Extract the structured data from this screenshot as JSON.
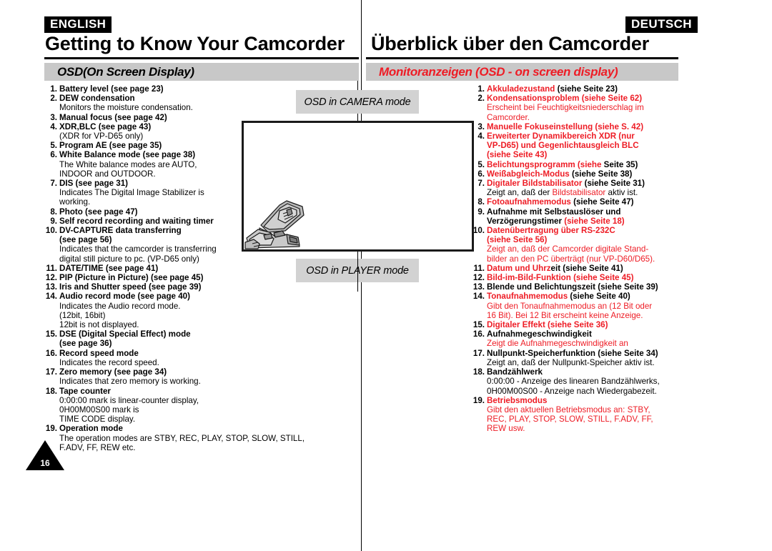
{
  "page": {
    "number": "16"
  },
  "left": {
    "language_badge": "ENGLISH",
    "chapter_title": "Getting to Know Your Camcorder",
    "section_band": "OSD(On Screen Display)",
    "items": [
      {
        "num": "1.",
        "lines": [
          {
            "t": "Battery level (see page 23)",
            "b": true,
            "c": "black"
          }
        ]
      },
      {
        "num": "2.",
        "lines": [
          {
            "t": "DEW condensation",
            "b": true,
            "c": "black"
          },
          {
            "t": "Monitors the moisture condensation.",
            "b": false,
            "c": "black"
          }
        ]
      },
      {
        "num": "3.",
        "lines": [
          {
            "t": "Manual focus (see page 42)",
            "b": true,
            "c": "black"
          }
        ]
      },
      {
        "num": "4.",
        "lines": [
          {
            "t": "XDR,BLC (see page 43)",
            "b": true,
            "c": "black"
          },
          {
            "t": "(XDR for VP-D65 only)",
            "b": false,
            "c": "black"
          }
        ]
      },
      {
        "num": "5.",
        "lines": [
          {
            "t": "Program AE (see page 35)",
            "b": true,
            "c": "black"
          }
        ]
      },
      {
        "num": "6.",
        "lines": [
          {
            "t": "White Balance mode (see page 38)",
            "b": true,
            "c": "black"
          },
          {
            "t": "The White balance modes are AUTO,",
            "b": false,
            "c": "black"
          },
          {
            "t": "INDOOR and OUTDOOR.",
            "b": false,
            "c": "black"
          }
        ]
      },
      {
        "num": "7.",
        "lines": [
          {
            "t": "DIS (see page 31)",
            "b": true,
            "c": "black"
          },
          {
            "t": "Indicates The Digital Image Stabilizer is",
            "b": false,
            "c": "black"
          },
          {
            "t": "working.",
            "b": false,
            "c": "black"
          }
        ]
      },
      {
        "num": "8.",
        "lines": [
          {
            "t": "Photo (see page 47)",
            "b": true,
            "c": "black"
          }
        ]
      },
      {
        "num": "9.",
        "lines": [
          {
            "t": "Self record recording and waiting timer",
            "b": true,
            "c": "black"
          }
        ]
      },
      {
        "num": "10.",
        "lines": [
          {
            "t": "DV-CAPTURE data transferring",
            "b": true,
            "c": "black"
          },
          {
            "t": "(see page 56)",
            "b": true,
            "c": "black",
            "ind": true
          },
          {
            "t": "Indicates that the camcorder is transferring",
            "b": false,
            "c": "black",
            "ind": true
          },
          {
            "t": "digital still picture to pc. (VP-D65 only)",
            "b": false,
            "c": "black",
            "ind": true
          }
        ]
      },
      {
        "num": "11.",
        "lines": [
          {
            "t": "DATE/TIME (see page 41)",
            "b": true,
            "c": "black"
          }
        ]
      },
      {
        "num": "12.",
        "lines": [
          {
            "t": "PIP (Picture in Picture) (see page 45)",
            "b": true,
            "c": "black"
          }
        ]
      },
      {
        "num": "13.",
        "lines": [
          {
            "t": "Iris and Shutter speed (see page 39)",
            "b": true,
            "c": "black"
          }
        ]
      },
      {
        "num": "14.",
        "lines": [
          {
            "t": "Audio record mode (see page 40)",
            "b": true,
            "c": "black"
          },
          {
            "t": "Indicates the Audio record mode.",
            "b": false,
            "c": "black"
          },
          {
            "t": "(12bit, 16bit)",
            "b": false,
            "c": "black"
          },
          {
            "t": "12bit is not displayed.",
            "b": false,
            "c": "black"
          }
        ]
      },
      {
        "num": "15.",
        "lines": [
          {
            "t": "DSE (Digital Special Effect) mode",
            "b": true,
            "c": "black"
          },
          {
            "t": "(see page 36)",
            "b": true,
            "c": "black",
            "ind": true
          }
        ]
      },
      {
        "num": "16.",
        "lines": [
          {
            "t": "Record speed mode",
            "b": true,
            "c": "black"
          },
          {
            "t": "Indicates the record speed.",
            "b": false,
            "c": "black"
          }
        ]
      },
      {
        "num": "17.",
        "lines": [
          {
            "t": "Zero memory (see page 34)",
            "b": true,
            "c": "black"
          },
          {
            "t": "Indicates that zero memory is working.",
            "b": false,
            "c": "black"
          }
        ]
      },
      {
        "num": "18.",
        "lines": [
          {
            "t": "Tape counter",
            "b": true,
            "c": "black"
          },
          {
            "t": "0:00:00 mark is linear-counter display,",
            "b": false,
            "c": "black"
          },
          {
            "t": "0H00M00S00 mark is",
            "b": false,
            "c": "black"
          },
          {
            "t": "TIME CODE display.",
            "b": false,
            "c": "black"
          }
        ]
      },
      {
        "num": "19.",
        "lines": [
          {
            "t": "Operation mode",
            "b": true,
            "c": "black"
          },
          {
            "t": "The operation modes are STBY, REC, PLAY, STOP, SLOW, STILL,",
            "b": false,
            "c": "black",
            "wide": true
          },
          {
            "t": "F.ADV, FF, REW etc.",
            "b": false,
            "c": "black",
            "wide": true
          }
        ]
      }
    ]
  },
  "right": {
    "language_badge": "DEUTSCH",
    "chapter_title": "Überblick über den Camcorder",
    "section_band": "Monitoranzeigen (OSD - on screen display)",
    "items": [
      {
        "num": "1.",
        "lines": [
          {
            "parts": [
              {
                "t": "Akkuladezustand ",
                "c": "red"
              },
              {
                "t": "(siehe Seite 23)",
                "c": "black"
              }
            ],
            "b": true
          }
        ]
      },
      {
        "num": "2.",
        "lines": [
          {
            "t": "Kondensationsproblem (siehe Seite 62)",
            "b": true,
            "c": "red"
          },
          {
            "t": "Erscheint bei Feuchtigkeitsniederschlag im",
            "b": false,
            "c": "red"
          },
          {
            "t": "Camcorder.",
            "b": false,
            "c": "red"
          }
        ]
      },
      {
        "num": "3.",
        "lines": [
          {
            "parts": [
              {
                "t": "Manuelle Fokuseinstellung ",
                "c": "red"
              },
              {
                "t": "(siehe S. 42)",
                "c": "red"
              }
            ],
            "b": true
          }
        ]
      },
      {
        "num": "4.",
        "lines": [
          {
            "t": "Erweiterter Dynamikbereich XDR (nur",
            "b": true,
            "c": "red"
          },
          {
            "t": "VP-D65) und Gegenlichtausgleich BLC",
            "b": true,
            "c": "red",
            "ind": true
          },
          {
            "t": "(siehe Seite 43)",
            "b": true,
            "c": "red",
            "ind": true
          }
        ]
      },
      {
        "num": "5.",
        "lines": [
          {
            "parts": [
              {
                "t": "Belichtungsprogramm (siehe ",
                "c": "red"
              },
              {
                "t": "Seite 35)",
                "c": "black"
              }
            ],
            "b": true
          }
        ]
      },
      {
        "num": "6.",
        "lines": [
          {
            "parts": [
              {
                "t": "Weißabgleich-Modus ",
                "c": "red"
              },
              {
                "t": "(siehe Seite 38)",
                "c": "black"
              }
            ],
            "b": true
          }
        ]
      },
      {
        "num": "7.",
        "lines": [
          {
            "parts": [
              {
                "t": "Digitaler Bildstabilisator ",
                "c": "red"
              },
              {
                "t": "(siehe Seite 31)",
                "c": "black"
              }
            ],
            "b": true
          },
          {
            "parts": [
              {
                "t": "Zeigt an, daß der ",
                "c": "black"
              },
              {
                "t": "Bildstabilisator ",
                "c": "red"
              },
              {
                "t": "aktiv ist.",
                "c": "black"
              }
            ],
            "b": false
          }
        ]
      },
      {
        "num": "8.",
        "lines": [
          {
            "parts": [
              {
                "t": "Fotoaufnahmemodus ",
                "c": "red"
              },
              {
                "t": "(siehe Seite 47)",
                "c": "black"
              }
            ],
            "b": true
          }
        ]
      },
      {
        "num": "9.",
        "lines": [
          {
            "t": "Aufnahme mit Selbstauslöser und",
            "b": true,
            "c": "black"
          },
          {
            "parts": [
              {
                "t": "Verzögerungstimer ",
                "c": "black"
              },
              {
                "t": "(siehe Seite 18)",
                "c": "red"
              }
            ],
            "b": true,
            "ind": true
          }
        ]
      },
      {
        "num": "10.",
        "lines": [
          {
            "t": "Datenübertragung über RS-232C",
            "b": true,
            "c": "red"
          },
          {
            "t": "(siehe Seite 56)",
            "b": true,
            "c": "red",
            "ind": true
          },
          {
            "t": "Zeigt an, daß der Camcorder digitale Stand-",
            "b": false,
            "c": "red",
            "ind": true
          },
          {
            "t": "bilder an den PC überträgt (nur VP-D60/D65).",
            "b": false,
            "c": "red",
            "ind": true
          }
        ]
      },
      {
        "num": "11.",
        "lines": [
          {
            "parts": [
              {
                "t": "Datum und Uhrz",
                "c": "red"
              },
              {
                "t": "eit (siehe Seite 41)",
                "c": "black"
              }
            ],
            "b": true
          }
        ]
      },
      {
        "num": "12.",
        "lines": [
          {
            "t": "Bild-im-Bild-Funktion (siehe Seite 45)",
            "b": true,
            "c": "red"
          }
        ]
      },
      {
        "num": "13.",
        "lines": [
          {
            "t": "Blende und Belichtungszeit (siehe Seite 39)",
            "b": true,
            "c": "black"
          }
        ]
      },
      {
        "num": "14.",
        "lines": [
          {
            "parts": [
              {
                "t": "Tonaufnahmemodus ",
                "c": "red"
              },
              {
                "t": "(siehe Seite 40)",
                "c": "black"
              }
            ],
            "b": true
          },
          {
            "t": "Gibt den Tonaufnahmemodus an (12 Bit oder",
            "b": false,
            "c": "red",
            "ind": true
          },
          {
            "t": "16 Bit). Bei 12 Bit erscheint keine Anzeige.",
            "b": false,
            "c": "red",
            "ind": true
          }
        ]
      },
      {
        "num": "15.",
        "lines": [
          {
            "t": "Digitaler Effekt (siehe Seite 36)",
            "b": true,
            "c": "red"
          }
        ]
      },
      {
        "num": "16.",
        "lines": [
          {
            "t": "Aufnahmegeschwindigkeit",
            "b": true,
            "c": "black"
          },
          {
            "t": "Zeigt die Aufnahmegeschwindigkeit an",
            "b": false,
            "c": "red"
          }
        ]
      },
      {
        "num": "17.",
        "lines": [
          {
            "t": "Nullpunkt-Speicherfunktion (siehe Seite 34)",
            "b": true,
            "c": "black"
          },
          {
            "t": "Zeigt an, daß der Nullpunkt-Speicher aktiv ist.",
            "b": false,
            "c": "black"
          }
        ]
      },
      {
        "num": "18.",
        "lines": [
          {
            "t": "Bandzählwerk",
            "b": true,
            "c": "black"
          },
          {
            "t": "0:00:00 - Anzeige des linearen Bandzählwerks,",
            "b": false,
            "c": "black"
          },
          {
            "t": "0H00M00S00 - Anzeige nach Wiedergabezeit.",
            "b": false,
            "c": "black"
          }
        ]
      },
      {
        "num": "19.",
        "lines": [
          {
            "t": "Betriebsmodus",
            "b": true,
            "c": "red"
          },
          {
            "t": "Gibt den aktuellen Betriebsmodus an: STBY,",
            "b": false,
            "c": "red"
          },
          {
            "t": "REC, PLAY, STOP, SLOW, STILL, F.ADV, FF,",
            "b": false,
            "c": "red"
          },
          {
            "t": "REW usw.",
            "b": false,
            "c": "red"
          }
        ]
      }
    ]
  },
  "center": {
    "camera_mode_label": "OSD in CAMERA mode",
    "player_mode_label": "OSD in PLAYER mode",
    "illustration": "camcorder-illustration"
  },
  "colors": {
    "accent_red": "#ee1c25",
    "band_gray": "#c8c8c8",
    "mode_band_gray": "#d2d2d2",
    "ink": "#000000"
  }
}
